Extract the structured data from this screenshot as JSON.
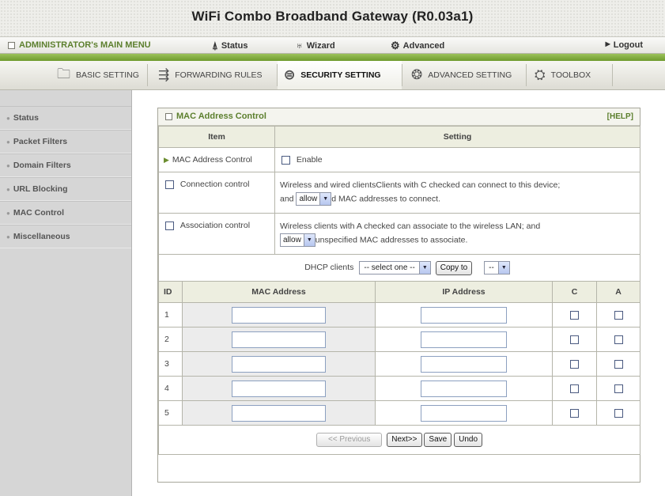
{
  "window": {
    "title": "WiFi Combo Broadband Gateway (R0.03a1)"
  },
  "main_menu": {
    "admin_label": "ADMINISTRATOR's MAIN MENU",
    "status": "Status",
    "wizard": "Wizard",
    "advanced": "Advanced",
    "logout": "Logout"
  },
  "sub_menu": {
    "basic": "BASIC SETTING",
    "forwarding": "FORWARDING RULES",
    "security": "SECURITY SETTING",
    "advanced": "ADVANCED SETTING",
    "toolbox": "TOOLBOX",
    "active": "SECURITY SETTING"
  },
  "sidebar": {
    "items": [
      {
        "label": "Status"
      },
      {
        "label": "Packet Filters"
      },
      {
        "label": "Domain Filters"
      },
      {
        "label": "URL Blocking"
      },
      {
        "label": "MAC Control"
      },
      {
        "label": "Miscellaneous"
      }
    ]
  },
  "panel": {
    "title": "MAC Address Control",
    "help": "[HELP]",
    "col_item": "Item",
    "col_setting": "Setting",
    "mac_control": {
      "label": "MAC Address Control",
      "enable_label": "Enable",
      "enabled": false
    },
    "connection_control": {
      "label": "Connection control",
      "checked": false,
      "text1": "Wireless and wired clientsClients with C checked can connect to this device;",
      "text2_pre": "and",
      "select_value": "allow",
      "text2_post": "d MAC addresses to connect."
    },
    "association_control": {
      "label": "Association control",
      "checked": false,
      "text1": "Wireless clients with A checked can associate to the wireless LAN; and",
      "select_value": "allow",
      "text2_post": "unspecified MAC addresses to associate."
    },
    "dhcp": {
      "label": "DHCP clients",
      "select_value": "-- select one --",
      "copy_button": "Copy to",
      "target_value": "--"
    },
    "table": {
      "headers": {
        "id": "ID",
        "mac": "MAC Address",
        "ip": "IP Address",
        "c": "C",
        "a": "A"
      },
      "rows": [
        {
          "id": "1",
          "mac": "",
          "ip": "",
          "c": false,
          "a": false
        },
        {
          "id": "2",
          "mac": "",
          "ip": "",
          "c": false,
          "a": false
        },
        {
          "id": "3",
          "mac": "",
          "ip": "",
          "c": false,
          "a": false
        },
        {
          "id": "4",
          "mac": "",
          "ip": "",
          "c": false,
          "a": false
        },
        {
          "id": "5",
          "mac": "",
          "ip": "",
          "c": false,
          "a": false
        }
      ]
    },
    "buttons": {
      "previous": "<< Previous",
      "next": "Next>>",
      "save": "Save",
      "undo": "Undo"
    }
  },
  "colors": {
    "accent_green": "#5c7f2d",
    "stripe_green": "#8ab44a",
    "sidebar_bg": "#d6d6d6",
    "header_bg": "#edeee0"
  },
  "icons": {
    "status": "antenna-icon",
    "wizard": "wizard-hat-icon",
    "advanced": "advanced-tools-icon",
    "basic": "folder-icon",
    "forwarding": "forward-arrows-icon",
    "security": "lock-icon",
    "advanced_setting": "gears-icon",
    "toolbox": "toolbox-icon"
  }
}
